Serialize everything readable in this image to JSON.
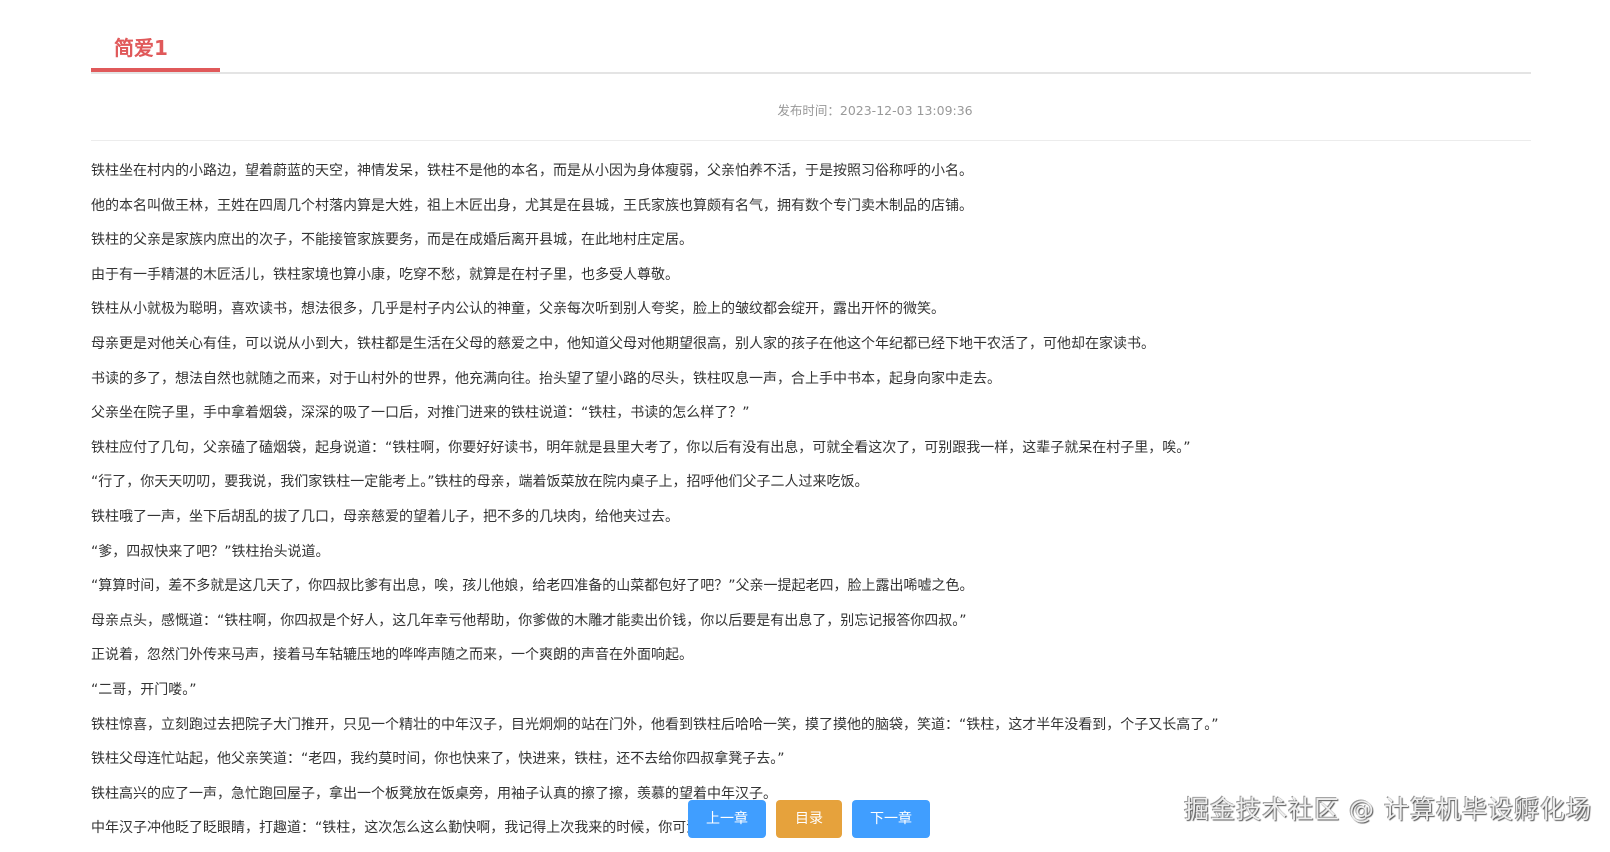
{
  "tab": {
    "title": "简爱1"
  },
  "meta": {
    "publish_label": "发布时间：",
    "publish_time": "2023-12-03 13:09:36"
  },
  "paragraphs": [
    "铁柱坐在村内的小路边，望着蔚蓝的天空，神情发呆，铁柱不是他的本名，而是从小因为身体瘦弱，父亲怕养不活，于是按照习俗称呼的小名。",
    "他的本名叫做王林，王姓在四周几个村落内算是大姓，祖上木匠出身，尤其是在县城，王氏家族也算颇有名气，拥有数个专门卖木制品的店铺。",
    "铁柱的父亲是家族内庶出的次子，不能接管家族要务，而是在成婚后离开县城，在此地村庄定居。",
    "由于有一手精湛的木匠活儿，铁柱家境也算小康，吃穿不愁，就算是在村子里，也多受人尊敬。",
    "铁柱从小就极为聪明，喜欢读书，想法很多，几乎是村子内公认的神童，父亲每次听到别人夸奖，脸上的皱纹都会绽开，露出开怀的微笑。",
    "母亲更是对他关心有佳，可以说从小到大，铁柱都是生活在父母的慈爱之中，他知道父母对他期望很高，别人家的孩子在他这个年纪都已经下地干农活了，可他却在家读书。",
    "书读的多了，想法自然也就随之而来，对于山村外的世界，他充满向往。抬头望了望小路的尽头，铁柱叹息一声，合上手中书本，起身向家中走去。",
    "父亲坐在院子里，手中拿着烟袋，深深的吸了一口后，对推门进来的铁柱说道：“铁柱，书读的怎么样了？”",
    "铁柱应付了几句，父亲磕了磕烟袋，起身说道：“铁柱啊，你要好好读书，明年就是县里大考了，你以后有没有出息，可就全看这次了，可别跟我一样，这辈子就呆在村子里，唉。”",
    "“行了，你天天叨叨，要我说，我们家铁柱一定能考上。”铁柱的母亲，端着饭菜放在院内桌子上，招呼他们父子二人过来吃饭。",
    "铁柱哦了一声，坐下后胡乱的拔了几口，母亲慈爱的望着儿子，把不多的几块肉，给他夹过去。",
    "“爹，四叔快来了吧？”铁柱抬头说道。",
    "“算算时间，差不多就是这几天了，你四叔比爹有出息，唉，孩儿他娘，给老四准备的山菜都包好了吧？”父亲一提起老四，脸上露出唏嘘之色。",
    "母亲点头，感慨道：“铁柱啊，你四叔是个好人，这几年幸亏他帮助，你爹做的木雕才能卖出价钱，你以后要是有出息了，别忘记报答你四叔。”",
    "正说着，忽然门外传来马声，接着马车轱辘压地的哗哗声随之而来，一个爽朗的声音在外面响起。",
    "“二哥，开门喽。”",
    "铁柱惊喜，立刻跑过去把院子大门推开，只见一个精壮的中年汉子，目光炯炯的站在门外，他看到铁柱后哈哈一笑，摸了摸他的脑袋，笑道：“铁柱，这才半年没看到，个子又长高了。”",
    "铁柱父母连忙站起，他父亲笑道：“老四，我约莫时间，你也快来了，快进来，铁柱，还不去给你四叔拿凳子去。”",
    "铁柱高兴的应了一声，急忙跑回屋子，拿出一个板凳放在饭桌旁，用袖子认真的擦了擦，羡慕的望着中年汉子。",
    "中年汉子冲他眨了眨眼睛，打趣道：“铁柱，这次怎么这么勤快啊，我记得上次我来的时候，你可没这样啊。”"
  ],
  "nav": {
    "prev": "上一章",
    "toc": "目录",
    "next": "下一章"
  },
  "watermark": "掘金技术社区 @ 计算机毕设孵化场",
  "colors": {
    "accent": "#e0595a",
    "primary": "#409eff",
    "warning": "#e6a23c"
  }
}
